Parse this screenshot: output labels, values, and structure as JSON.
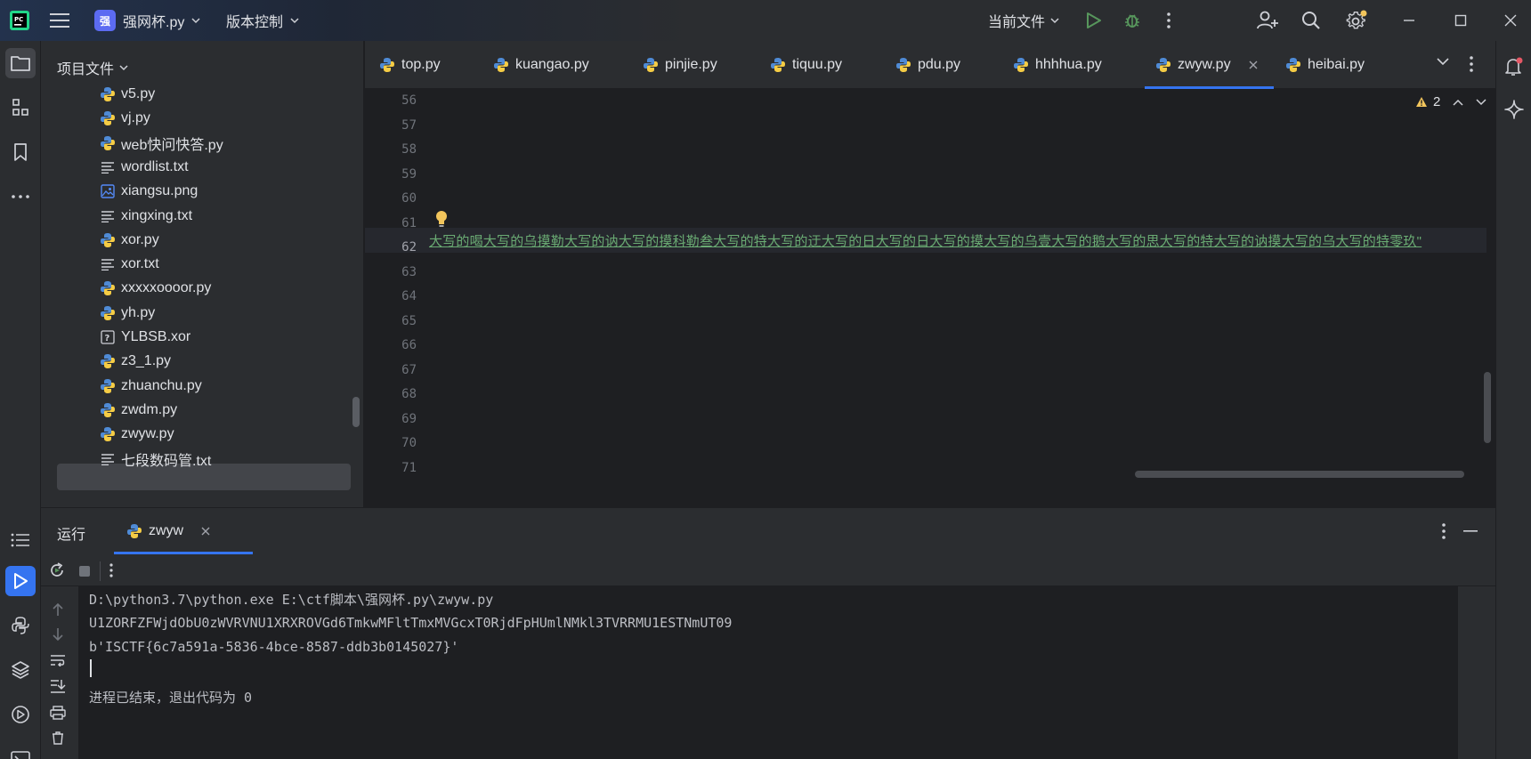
{
  "titlebar": {
    "project_badge": "强",
    "project_name": "强网杯.py",
    "vcs_label": "版本控制",
    "run_config": "当前文件"
  },
  "project_panel": {
    "title": "项目文件",
    "files": [
      {
        "name": "v5.py",
        "type": "py"
      },
      {
        "name": "vj.py",
        "type": "py"
      },
      {
        "name": "web快问快答.py",
        "type": "py"
      },
      {
        "name": "wordlist.txt",
        "type": "txt"
      },
      {
        "name": "xiangsu.png",
        "type": "img"
      },
      {
        "name": "xingxing.txt",
        "type": "txt"
      },
      {
        "name": "xor.py",
        "type": "py"
      },
      {
        "name": "xor.txt",
        "type": "txt"
      },
      {
        "name": "xxxxxoooor.py",
        "type": "py"
      },
      {
        "name": "yh.py",
        "type": "py"
      },
      {
        "name": "YLBSB.xor",
        "type": "unknown"
      },
      {
        "name": "z3_1.py",
        "type": "py"
      },
      {
        "name": "zhuanchu.py",
        "type": "py"
      },
      {
        "name": "zwdm.py",
        "type": "py"
      },
      {
        "name": "zwyw.py",
        "type": "py"
      },
      {
        "name": "七段数码管.txt",
        "type": "txt"
      }
    ],
    "selected": "zwyw.py"
  },
  "editor_tabs": [
    {
      "label": "top.py"
    },
    {
      "label": "kuangao.py"
    },
    {
      "label": "pinjie.py"
    },
    {
      "label": "tiquu.py"
    },
    {
      "label": "pdu.py"
    },
    {
      "label": "hhhhua.py"
    },
    {
      "label": "zwyw.py",
      "active": true
    },
    {
      "label": "heibai.py"
    }
  ],
  "editor": {
    "line_numbers": [
      "56",
      "57",
      "58",
      "59",
      "60",
      "61",
      "62",
      "63",
      "64",
      "65",
      "66",
      "67",
      "68",
      "69",
      "70",
      "71"
    ],
    "current_line": "62",
    "code_line_62": "大写的喝大写的乌摸勒大写的讷大写的摸科勒叁大写的特大写的迂大写的日大写的日大写的摸大写的乌壹大写的鹅大写的思大写的特大写的讷摸大写的乌大写的特零玖\"",
    "warning_count": "2"
  },
  "run_panel": {
    "title": "运行",
    "tab_label": "zwyw",
    "console_lines": [
      "D:\\python3.7\\python.exe E:\\ctf脚本\\强网杯.py\\zwyw.py",
      "U1ZORFZFWjdObU0zWVRVNU1XRXROVGd6TmkwMFltTmxMVGcxT0RjdFpHUmlNMkl3TVRRMU1ESTNmUT09",
      "b'ISCTF{6c7a591a-5836-4bce-8587-ddb3b0145027}'",
      "",
      "进程已结束，退出代码为 0"
    ]
  },
  "colors": {
    "accent": "#3574f0",
    "string_green": "#6aab73",
    "run_green": "#57965c",
    "notification_dot": "#e55765",
    "settings_dot": "#f2c55c"
  }
}
